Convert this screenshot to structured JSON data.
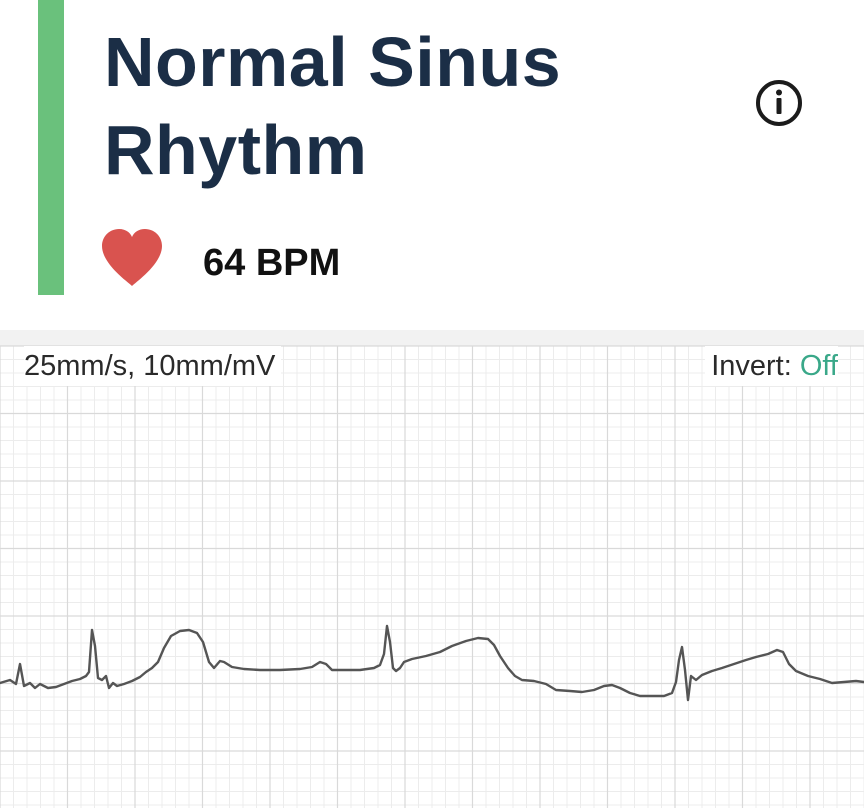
{
  "header": {
    "title": "Normal Sinus Rhythm",
    "heart_rate": "64 BPM",
    "accent_color": "#6ac17c",
    "title_color": "#1b2e46",
    "heart_color": "#d9534f"
  },
  "icons": {
    "info": "info-circle-icon",
    "heart": "heart-icon"
  },
  "ecg": {
    "speed_label": "25mm/s, 10mm/mV",
    "invert_label": "Invert:",
    "invert_value": "Off",
    "invert_color": "#3aa889"
  }
}
